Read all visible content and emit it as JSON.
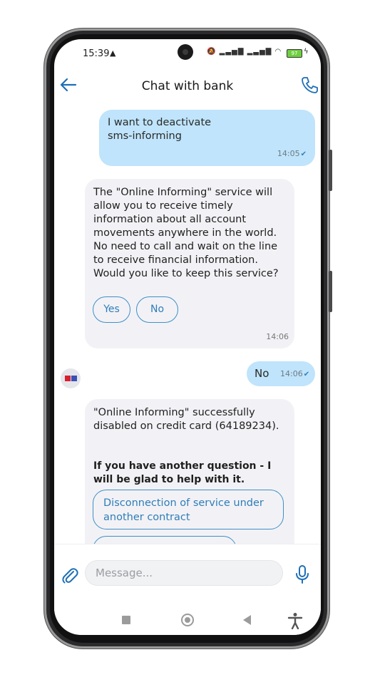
{
  "status_bar": {
    "time": "15:39",
    "battery": "97",
    "icons": [
      "warning-icon",
      "mute-icon",
      "signal-icon",
      "signal-icon",
      "wifi-icon",
      "battery-icon",
      "charging-icon"
    ]
  },
  "header": {
    "title": "Chat with bank",
    "icons": [
      "back-arrow-icon",
      "phone-icon"
    ]
  },
  "chat": {
    "messages": [
      {
        "from": "user",
        "text": "I want to deactivate\nsms-informing",
        "time": "14:05",
        "status": "read"
      },
      {
        "from": "bank",
        "text": "The \"Online Informing\" service will allow you to receive timely information about all account movements anywhere in the world. No need to call and wait on the line to receive financial information. Would you like to keep this service?",
        "time": "14:06",
        "quick_replies": [
          "Yes",
          "No"
        ]
      },
      {
        "from": "user",
        "text": "No",
        "time": "14:06",
        "status": "read"
      },
      {
        "from": "bank",
        "text": "\"Online Informing\" successfully disabled on credit card (64189234).",
        "bold_text": "If you have another question - I will be glad to help with it.",
        "quick_replies": [
          "Disconnection of service under another contract"
        ]
      }
    ]
  },
  "input": {
    "placeholder": "Message..."
  },
  "colors": {
    "accent": "#1f6fb5",
    "outgoing_bubble": "#bfe4fb",
    "incoming_bubble": "#f2f2f6",
    "chip_border": "#3f8fc6"
  }
}
